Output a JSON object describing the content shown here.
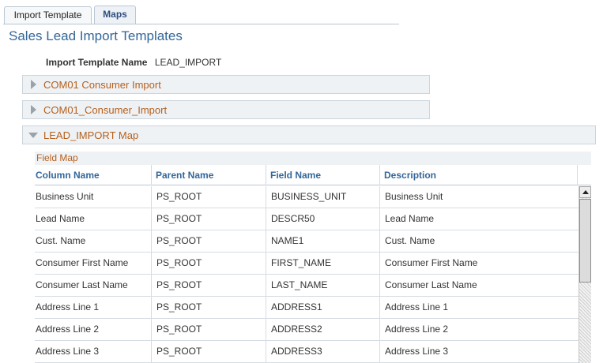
{
  "tabs": [
    {
      "label": "Import Template"
    },
    {
      "label": "Maps"
    }
  ],
  "page": {
    "title": "Sales Lead Import Templates"
  },
  "template": {
    "name_label": "Import Template Name",
    "name_value": "LEAD_IMPORT"
  },
  "sections": [
    {
      "label": "COM01 Consumer Import",
      "expanded": false
    },
    {
      "label": "COM01_Consumer_Import",
      "expanded": false
    },
    {
      "label": "LEAD_IMPORT Map",
      "expanded": true
    }
  ],
  "field_map": {
    "caption": "Field Map",
    "columns": [
      "Column Name",
      "Parent Name",
      "Field Name",
      "Description"
    ],
    "rows": [
      [
        "Business Unit",
        "PS_ROOT",
        "BUSINESS_UNIT",
        "Business Unit"
      ],
      [
        "Lead Name",
        "PS_ROOT",
        "DESCR50",
        "Lead Name"
      ],
      [
        "Cust. Name",
        "PS_ROOT",
        "NAME1",
        "Cust. Name"
      ],
      [
        "Consumer First Name",
        "PS_ROOT",
        "FIRST_NAME",
        "Consumer First Name"
      ],
      [
        "Consumer Last Name",
        "PS_ROOT",
        "LAST_NAME",
        "Consumer Last Name"
      ],
      [
        "Address Line 1",
        "PS_ROOT",
        "ADDRESS1",
        "Address Line 1"
      ],
      [
        "Address Line 2",
        "PS_ROOT",
        "ADDRESS2",
        "Address Line 2"
      ],
      [
        "Address Line 3",
        "PS_ROOT",
        "ADDRESS3",
        "Address Line 3"
      ]
    ]
  },
  "colors": {
    "title": "#336699",
    "section_label": "#b5601d",
    "header_text": "#336699"
  }
}
